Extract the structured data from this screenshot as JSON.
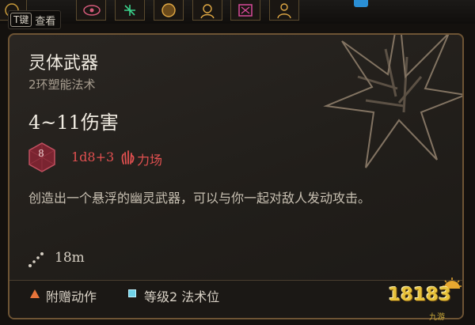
{
  "hotbar": {
    "slot_icons": [
      "skull-icon",
      "eye-icon",
      "rune-icon",
      "mask-icon",
      "face-icon",
      "rune-icon",
      "figure-icon"
    ]
  },
  "key_hint": {
    "key": "T键",
    "label": "查看"
  },
  "tooltip": {
    "title": "灵体武器",
    "subtitle": "2环塑能法术",
    "damage": "4~11伤害",
    "dice_face": "8",
    "formula": "1d8+3",
    "damage_type": "力场",
    "description": "创造出一个悬浮的幽灵武器，可以与你一起对敌人发动攻击。",
    "range": "18m",
    "footer": {
      "action": "附赠动作",
      "slot": "等级2 法术位"
    }
  },
  "watermark": {
    "main": "18183",
    "sub": "九游"
  },
  "colors": {
    "accent_red": "#e25050",
    "border": "#6e5434",
    "action_orange": "#e8743a",
    "slot_cyan": "#6fd2e8"
  }
}
